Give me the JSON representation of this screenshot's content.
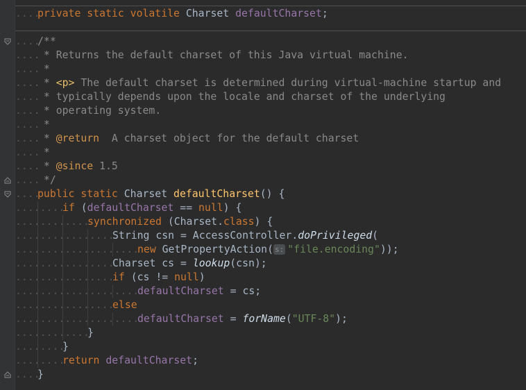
{
  "editor": {
    "field_line": {
      "kw1": "private",
      "kw2": "static",
      "kw3": "volatile",
      "type": "Charset",
      "field": "defaultCharset",
      "semi": ";"
    },
    "doc": {
      "open": "/**",
      "line1": " * Returns the default charset of this Java virtual machine.",
      "star": " *",
      "p_prefix": " * ",
      "p_tag": "<p>",
      "p_text": " The default charset is determined during virtual-machine startup and",
      "line_typ": " * typically depends upon the locale and charset of the underlying",
      "line_os": " * operating system.",
      "return_tag": "@return",
      "return_text": "  A charset object for the default charset",
      "since_tag": "@since",
      "since_text": " 1.5",
      "close": " */"
    },
    "method_sig": {
      "kw1": "public",
      "kw2": "static",
      "type": "Charset",
      "name": "defaultCharset",
      "rest": "() {"
    },
    "if1": {
      "kw": "if",
      "open": " (",
      "field": "defaultCharset",
      "op": " == ",
      "null": "null",
      "close": ") {"
    },
    "sync": {
      "kw": "synchronized",
      "open": " (Charset.",
      "cls": "class",
      "close": ") {"
    },
    "csn": {
      "decl": "String csn = AccessController.",
      "call": "doPrivileged",
      "paren": "("
    },
    "newline": {
      "kw": "new",
      "ctor": " GetPropertyAction(",
      "hint": "s:",
      "str": "\"file.encoding\"",
      "close": "));"
    },
    "cs": {
      "decl": "Charset cs = ",
      "call": "lookup",
      "rest": "(csn);"
    },
    "if2": {
      "kw": "if",
      "open": " (cs != ",
      "null": "null",
      "close": ")"
    },
    "assign1": {
      "field": "defaultCharset",
      "rest": " = cs;"
    },
    "else": "else",
    "assign2": {
      "field": "defaultCharset",
      "eq": " = ",
      "call": "forName",
      "open": "(",
      "str": "\"UTF-8\"",
      "close": ");"
    },
    "brace_close_sync": "}",
    "brace_close_if": "}",
    "ret": {
      "kw": "return",
      "field": " defaultCharset",
      "semi": ";"
    },
    "brace_close_method": "}"
  }
}
